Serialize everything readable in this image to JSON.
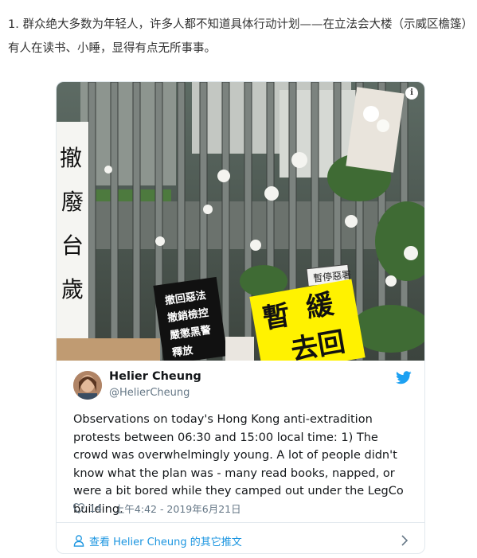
{
  "article": {
    "paragraph": "1. 群众绝大多数为年轻人，许多人都不知道具体行动计划——在立法会大楼（示威区檐篷）有人在读书、小睡，显得有点无所事事。"
  },
  "tweet": {
    "author_name": "Helier Cheung",
    "author_handle": "@HelierCheung",
    "text": "Observations on today's Hong Kong anti-extradition protests between 06:30 and 15:00 local time: 1) The crowd was overwhelmingly young. A lot of people didn't know what the plan was - many read books, napped, or were a bit bored while they camped out under the LegCo building.",
    "like_count": "14",
    "timestamp": "上午4:42 - 2019年6月21日",
    "more_link": "查看 Helier Cheung 的其它推文",
    "photo_signs": {
      "vertical_sign": "撤廢台歲",
      "black_sign_lines": [
        "撤回惡法",
        "撤銷檢控",
        "嚴懲黑警",
        "釋放"
      ],
      "small_sign": "暫停惡署",
      "yellow_sign": "暫緩去回"
    }
  },
  "colors": {
    "twitter_blue": "#1da1f2",
    "link_blue": "#1b95e0",
    "text": "#14171a",
    "muted": "#657786",
    "border": "#e1e8ed",
    "yellow_sign": "#fff200"
  },
  "icons": {
    "info": "info-icon",
    "twitter": "twitter-bird-icon",
    "heart": "heart-icon",
    "person": "person-icon",
    "chevron": "chevron-right-icon"
  }
}
